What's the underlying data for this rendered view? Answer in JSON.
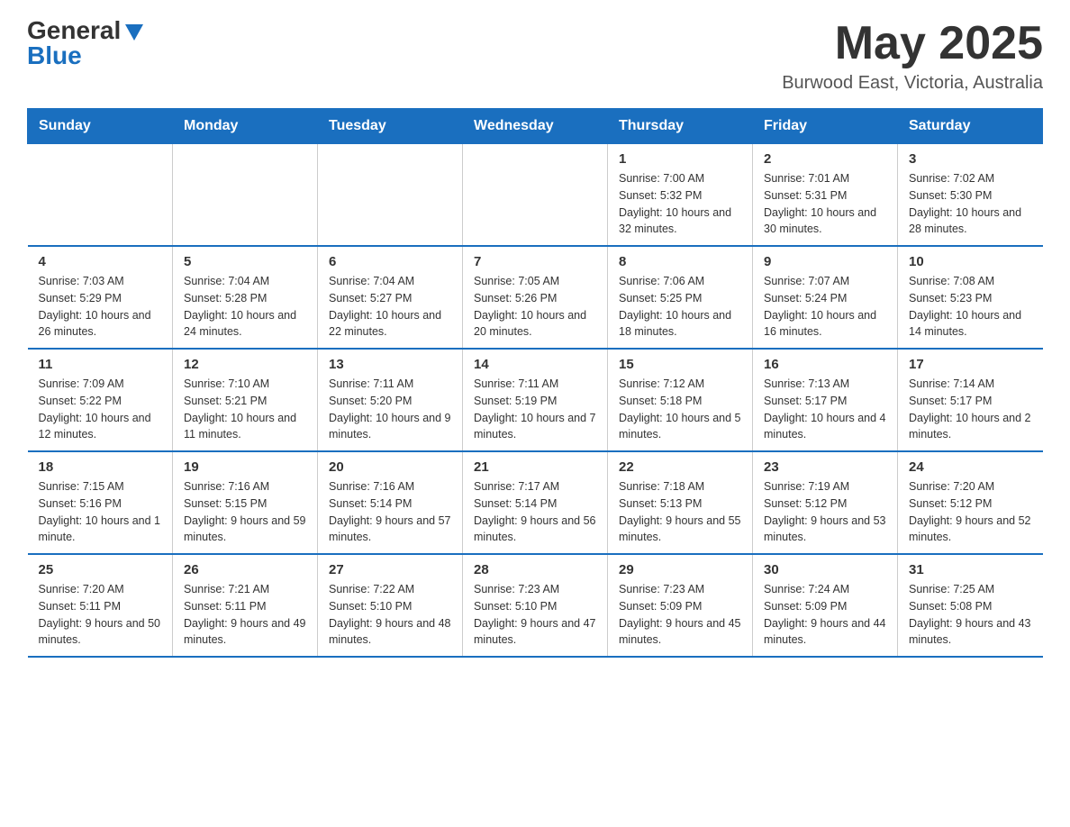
{
  "logo": {
    "general": "General",
    "blue": "Blue"
  },
  "header": {
    "month_year": "May 2025",
    "location": "Burwood East, Victoria, Australia"
  },
  "days_of_week": [
    "Sunday",
    "Monday",
    "Tuesday",
    "Wednesday",
    "Thursday",
    "Friday",
    "Saturday"
  ],
  "weeks": [
    [
      {
        "day": "",
        "info": ""
      },
      {
        "day": "",
        "info": ""
      },
      {
        "day": "",
        "info": ""
      },
      {
        "day": "",
        "info": ""
      },
      {
        "day": "1",
        "info": "Sunrise: 7:00 AM\nSunset: 5:32 PM\nDaylight: 10 hours and 32 minutes."
      },
      {
        "day": "2",
        "info": "Sunrise: 7:01 AM\nSunset: 5:31 PM\nDaylight: 10 hours and 30 minutes."
      },
      {
        "day": "3",
        "info": "Sunrise: 7:02 AM\nSunset: 5:30 PM\nDaylight: 10 hours and 28 minutes."
      }
    ],
    [
      {
        "day": "4",
        "info": "Sunrise: 7:03 AM\nSunset: 5:29 PM\nDaylight: 10 hours and 26 minutes."
      },
      {
        "day": "5",
        "info": "Sunrise: 7:04 AM\nSunset: 5:28 PM\nDaylight: 10 hours and 24 minutes."
      },
      {
        "day": "6",
        "info": "Sunrise: 7:04 AM\nSunset: 5:27 PM\nDaylight: 10 hours and 22 minutes."
      },
      {
        "day": "7",
        "info": "Sunrise: 7:05 AM\nSunset: 5:26 PM\nDaylight: 10 hours and 20 minutes."
      },
      {
        "day": "8",
        "info": "Sunrise: 7:06 AM\nSunset: 5:25 PM\nDaylight: 10 hours and 18 minutes."
      },
      {
        "day": "9",
        "info": "Sunrise: 7:07 AM\nSunset: 5:24 PM\nDaylight: 10 hours and 16 minutes."
      },
      {
        "day": "10",
        "info": "Sunrise: 7:08 AM\nSunset: 5:23 PM\nDaylight: 10 hours and 14 minutes."
      }
    ],
    [
      {
        "day": "11",
        "info": "Sunrise: 7:09 AM\nSunset: 5:22 PM\nDaylight: 10 hours and 12 minutes."
      },
      {
        "day": "12",
        "info": "Sunrise: 7:10 AM\nSunset: 5:21 PM\nDaylight: 10 hours and 11 minutes."
      },
      {
        "day": "13",
        "info": "Sunrise: 7:11 AM\nSunset: 5:20 PM\nDaylight: 10 hours and 9 minutes."
      },
      {
        "day": "14",
        "info": "Sunrise: 7:11 AM\nSunset: 5:19 PM\nDaylight: 10 hours and 7 minutes."
      },
      {
        "day": "15",
        "info": "Sunrise: 7:12 AM\nSunset: 5:18 PM\nDaylight: 10 hours and 5 minutes."
      },
      {
        "day": "16",
        "info": "Sunrise: 7:13 AM\nSunset: 5:17 PM\nDaylight: 10 hours and 4 minutes."
      },
      {
        "day": "17",
        "info": "Sunrise: 7:14 AM\nSunset: 5:17 PM\nDaylight: 10 hours and 2 minutes."
      }
    ],
    [
      {
        "day": "18",
        "info": "Sunrise: 7:15 AM\nSunset: 5:16 PM\nDaylight: 10 hours and 1 minute."
      },
      {
        "day": "19",
        "info": "Sunrise: 7:16 AM\nSunset: 5:15 PM\nDaylight: 9 hours and 59 minutes."
      },
      {
        "day": "20",
        "info": "Sunrise: 7:16 AM\nSunset: 5:14 PM\nDaylight: 9 hours and 57 minutes."
      },
      {
        "day": "21",
        "info": "Sunrise: 7:17 AM\nSunset: 5:14 PM\nDaylight: 9 hours and 56 minutes."
      },
      {
        "day": "22",
        "info": "Sunrise: 7:18 AM\nSunset: 5:13 PM\nDaylight: 9 hours and 55 minutes."
      },
      {
        "day": "23",
        "info": "Sunrise: 7:19 AM\nSunset: 5:12 PM\nDaylight: 9 hours and 53 minutes."
      },
      {
        "day": "24",
        "info": "Sunrise: 7:20 AM\nSunset: 5:12 PM\nDaylight: 9 hours and 52 minutes."
      }
    ],
    [
      {
        "day": "25",
        "info": "Sunrise: 7:20 AM\nSunset: 5:11 PM\nDaylight: 9 hours and 50 minutes."
      },
      {
        "day": "26",
        "info": "Sunrise: 7:21 AM\nSunset: 5:11 PM\nDaylight: 9 hours and 49 minutes."
      },
      {
        "day": "27",
        "info": "Sunrise: 7:22 AM\nSunset: 5:10 PM\nDaylight: 9 hours and 48 minutes."
      },
      {
        "day": "28",
        "info": "Sunrise: 7:23 AM\nSunset: 5:10 PM\nDaylight: 9 hours and 47 minutes."
      },
      {
        "day": "29",
        "info": "Sunrise: 7:23 AM\nSunset: 5:09 PM\nDaylight: 9 hours and 45 minutes."
      },
      {
        "day": "30",
        "info": "Sunrise: 7:24 AM\nSunset: 5:09 PM\nDaylight: 9 hours and 44 minutes."
      },
      {
        "day": "31",
        "info": "Sunrise: 7:25 AM\nSunset: 5:08 PM\nDaylight: 9 hours and 43 minutes."
      }
    ]
  ]
}
